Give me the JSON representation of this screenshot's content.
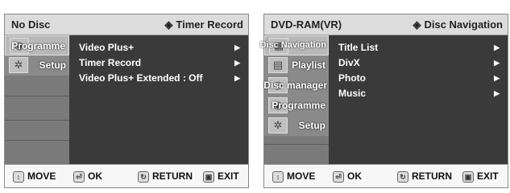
{
  "left": {
    "disc": "No Disc",
    "mode": "Timer Record",
    "sidebar": [
      {
        "label": "Programme",
        "icon": "film-reel"
      },
      {
        "label": "Setup",
        "icon": "gear"
      }
    ],
    "menu": [
      {
        "label": "Video Plus+",
        "arrow": "▶"
      },
      {
        "label": "Timer Record",
        "arrow": "▶"
      },
      {
        "label": "Video Plus+ Extended : Off",
        "arrow": "▶"
      }
    ],
    "footer": {
      "move": "MOVE",
      "ok": "OK",
      "return": "RETURN",
      "exit": "EXIT"
    }
  },
  "right": {
    "disc": "DVD-RAM(VR)",
    "mode": "Disc Navigation",
    "sidebar": [
      {
        "label": "Disc Navigation",
        "icon": "disc-nav"
      },
      {
        "label": "Playlist",
        "icon": "film"
      },
      {
        "label": "Disc manager",
        "icon": "disc"
      },
      {
        "label": "Programme",
        "icon": "film-reel"
      },
      {
        "label": "Setup",
        "icon": "gear"
      }
    ],
    "menu": [
      {
        "label": "Title List",
        "arrow": "▶"
      },
      {
        "label": "DivX",
        "arrow": "▶"
      },
      {
        "label": "Photo",
        "arrow": "▶"
      },
      {
        "label": "Music",
        "arrow": "▶"
      }
    ],
    "footer": {
      "move": "MOVE",
      "ok": "OK",
      "return": "RETURN",
      "exit": "EXIT"
    }
  }
}
